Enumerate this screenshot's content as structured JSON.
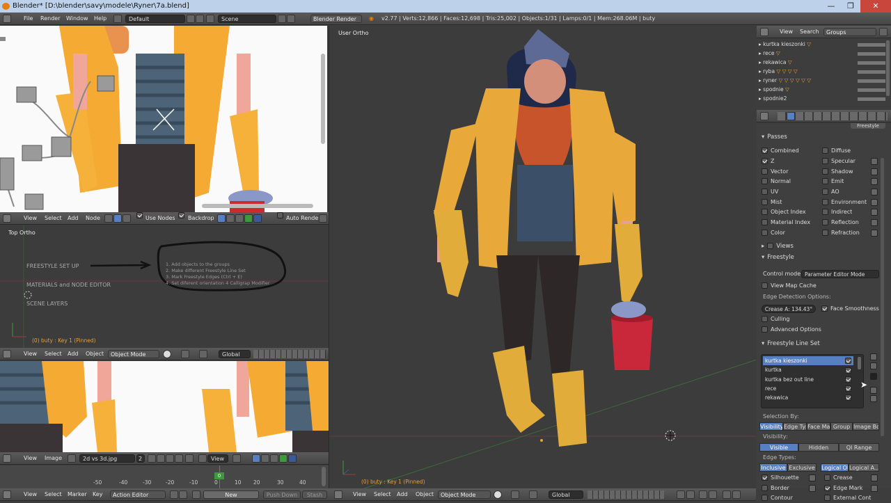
{
  "window": {
    "title": "Blender* [D:\\blender\\savy\\modele\\Ryner\\7a.blend]",
    "buttons": [
      "—",
      "❐",
      "✕"
    ]
  },
  "info_header": {
    "menus": [
      "File",
      "Render",
      "Window",
      "Help"
    ],
    "layout": "Default",
    "scene": "Scene",
    "engine": "Blender Render",
    "stats": "v2.77 | Verts:12,866 | Faces:12,698 | Tris:25,002 | Objects:1/31 | Lamps:0/1 | Mem:268.06M | buty"
  },
  "node_editor": {
    "menus": [
      "View",
      "Select",
      "Add",
      "Node"
    ],
    "use_nodes": "Use Nodes",
    "backdrop": "Backdrop",
    "auto_render": "Auto Render"
  },
  "notes_view": {
    "label": "Top Ortho",
    "items": [
      "FREESTYLE  SET UP",
      "MATERIALS  and  NODE EDITOR",
      "SCENE LAYERS"
    ],
    "steps": [
      "1.  Add objects to the groups",
      "2.  Make different Freestyle Line Set",
      "3.  Mark Freestyle Edges   (Ctrl + E)",
      "4.  Set diferent orientation 4 Calligrap Modifier"
    ],
    "status": "(0) buty : Key 1 (Pinned)"
  },
  "view3d_small": {
    "menus": [
      "View",
      "Select",
      "Add",
      "Object"
    ],
    "mode": "Object Mode",
    "orientation": "Global"
  },
  "image_editor": {
    "menus": [
      "View",
      "Image"
    ],
    "image": "2d vs 3d.jpg",
    "users": "2",
    "view": "View"
  },
  "timeline": {
    "ticks": [
      "-50",
      "-40",
      "-30",
      "-20",
      "-10",
      "0",
      "10",
      "20",
      "30",
      "40"
    ],
    "current": "0"
  },
  "action_editor": {
    "menus": [
      "View",
      "Select",
      "Marker",
      "Key"
    ],
    "mode": "Action Editor",
    "new": "New",
    "push_down": "Push Down",
    "stash": "Stash"
  },
  "main_view": {
    "label": "User Ortho",
    "status": "(0) buty : Key 1 (Pinned)",
    "menus": [
      "View",
      "Select",
      "Add",
      "Object"
    ],
    "mode": "Object Mode",
    "orientation": "Global"
  },
  "outliner": {
    "menus": [
      "View",
      "Search"
    ],
    "display": "Groups",
    "rows": [
      "kurtka kieszonki",
      "rece",
      "rekawica",
      "ryba",
      "ryner",
      "spodnie",
      "spodnie2"
    ]
  },
  "properties": {
    "freestyle_tab": "Freestyle",
    "passes_title": "Passes",
    "passes_left": [
      {
        "label": "Combined",
        "on": true
      },
      {
        "label": "Z",
        "on": true
      },
      {
        "label": "Vector",
        "on": false
      },
      {
        "label": "Normal",
        "on": false
      },
      {
        "label": "UV",
        "on": false
      },
      {
        "label": "Mist",
        "on": false
      },
      {
        "label": "Object Index",
        "on": false
      },
      {
        "label": "Material Index",
        "on": false
      },
      {
        "label": "Color",
        "on": false
      }
    ],
    "passes_right": [
      "Diffuse",
      "Specular",
      "Shadow",
      "Emit",
      "AO",
      "Environment",
      "Indirect",
      "Reflection",
      "Refraction"
    ],
    "views_title": "Views",
    "freestyle_title": "Freestyle",
    "control_mode_label": "Control mode:",
    "control_mode": "Parameter Editor Mode",
    "view_map_cache": "View Map Cache",
    "edge_detection": "Edge Detection Options:",
    "crease": "Crease A: 134.43°",
    "face_smoothness": "Face Smoothness",
    "culling": "Culling",
    "advanced": "Advanced Options",
    "lineset_title": "Freestyle Line Set",
    "linesets": [
      "kurtka kieszonki",
      "kurtka",
      "kurtka bez out line",
      "rece",
      "rekawica"
    ],
    "selection_by": "Selection By:",
    "sel_tabs": [
      "Visibility",
      "Edge Typ",
      "Face Mar",
      "Group",
      "Image Bor"
    ],
    "visibility_label": "Visibility:",
    "vis_tabs": [
      "Visible",
      "Hidden",
      "QI Range"
    ],
    "edge_types_label": "Edge Types:",
    "edge_tabs": [
      "Inclusive",
      "Exclusive",
      "Logical OR",
      "Logical A..."
    ],
    "edge_left": [
      "Silhouette",
      "Border",
      "Contour"
    ],
    "edge_right": [
      "Crease",
      "Edge Mark",
      "External Cont"
    ]
  },
  "colors": {
    "accent": "#5680c2",
    "viewport": "#3c3c3c",
    "header": "#4d4d4d",
    "jacket": "#e8a93a",
    "beard": "#c7542a",
    "bucket": "#c8283a"
  }
}
